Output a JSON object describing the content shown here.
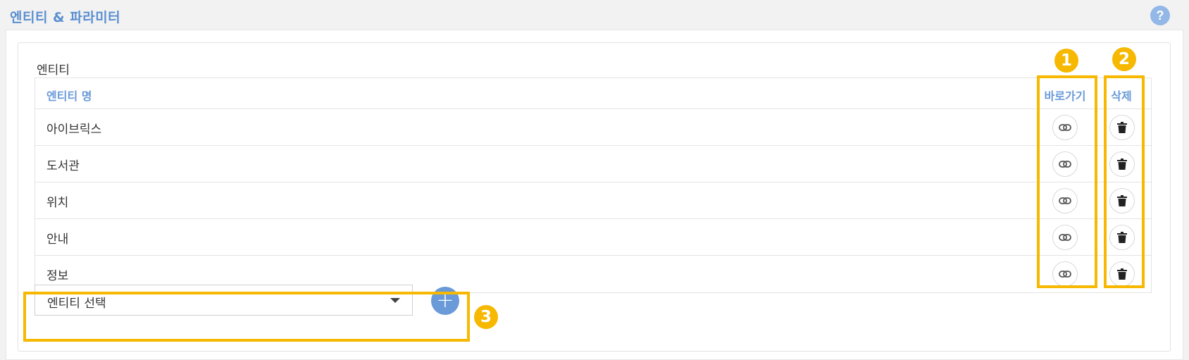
{
  "panel": {
    "title": "엔티티 & 파라미터",
    "help_icon": "?"
  },
  "section": {
    "label": "엔티티"
  },
  "table": {
    "headers": {
      "name": "엔티티 명",
      "link": "바로가기",
      "delete": "삭제"
    },
    "rows": [
      {
        "name": "아이브릭스"
      },
      {
        "name": "도서관"
      },
      {
        "name": "위치"
      },
      {
        "name": "안내"
      },
      {
        "name": "정보"
      }
    ]
  },
  "entity_select": {
    "value": "엔티티 선택"
  },
  "add_button": {
    "label": "+"
  },
  "annotations": {
    "badge_1": "1",
    "badge_2": "2",
    "badge_3": "3",
    "highlight_color": "#f6b800"
  },
  "colors": {
    "accent": "#6a9ad8",
    "help": "#93b7e6"
  }
}
